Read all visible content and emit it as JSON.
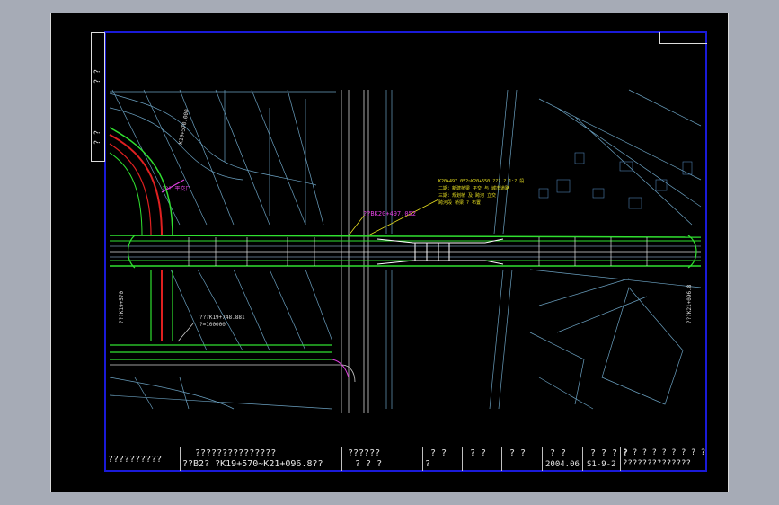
{
  "left_strip": {
    "mark_top": "? ?",
    "mark_bottom": "? ?"
  },
  "labels": {
    "station_left_top": "K19+570.000",
    "magenta_note": "??? 平交口",
    "road_code": "??BK20+497.052",
    "notes_line1": "K20+497.052~K20+550 ??? ? 1:? 段",
    "notes_line2": "二期：新建桥梁 平交 与 城市道路",
    "notes_line3": "三期：规划桥 及 跨河 立交",
    "notes_line4": "跨河段 桥梁 ? 布置",
    "station_left_bottom": "???K19+570",
    "station_mid": "???K19+748.881",
    "station_mid2": "?=100000",
    "station_right": "???K21+096.8"
  },
  "title_block": {
    "project": "??????????",
    "drawing_title_1": "???????????????",
    "drawing_title_2": "??B2? ?K19+570~K21+096.8??",
    "c3_top": "??????",
    "c3_bottom": "?   ?   ?",
    "c4_top": "?  ?",
    "c4_bottom": "?",
    "c5_top": "?  ?",
    "c6_top": "?  ?",
    "c7_top": "?  ?",
    "date": "2004.06",
    "c8_top": "?  ?",
    "sheet_no": "S1-9-2",
    "c9_top": "?  ?",
    "c10_top": "? ? ? ? ? ? ? ? ?",
    "c10_bottom": "??????????????"
  },
  "colors": {
    "frame": "#1a1ad8",
    "road": "#30e030",
    "axis_red": "#e02020",
    "linework": "#7fb8c8",
    "note_magenta": "#e040e0",
    "note_yellow": "#e8e020"
  }
}
